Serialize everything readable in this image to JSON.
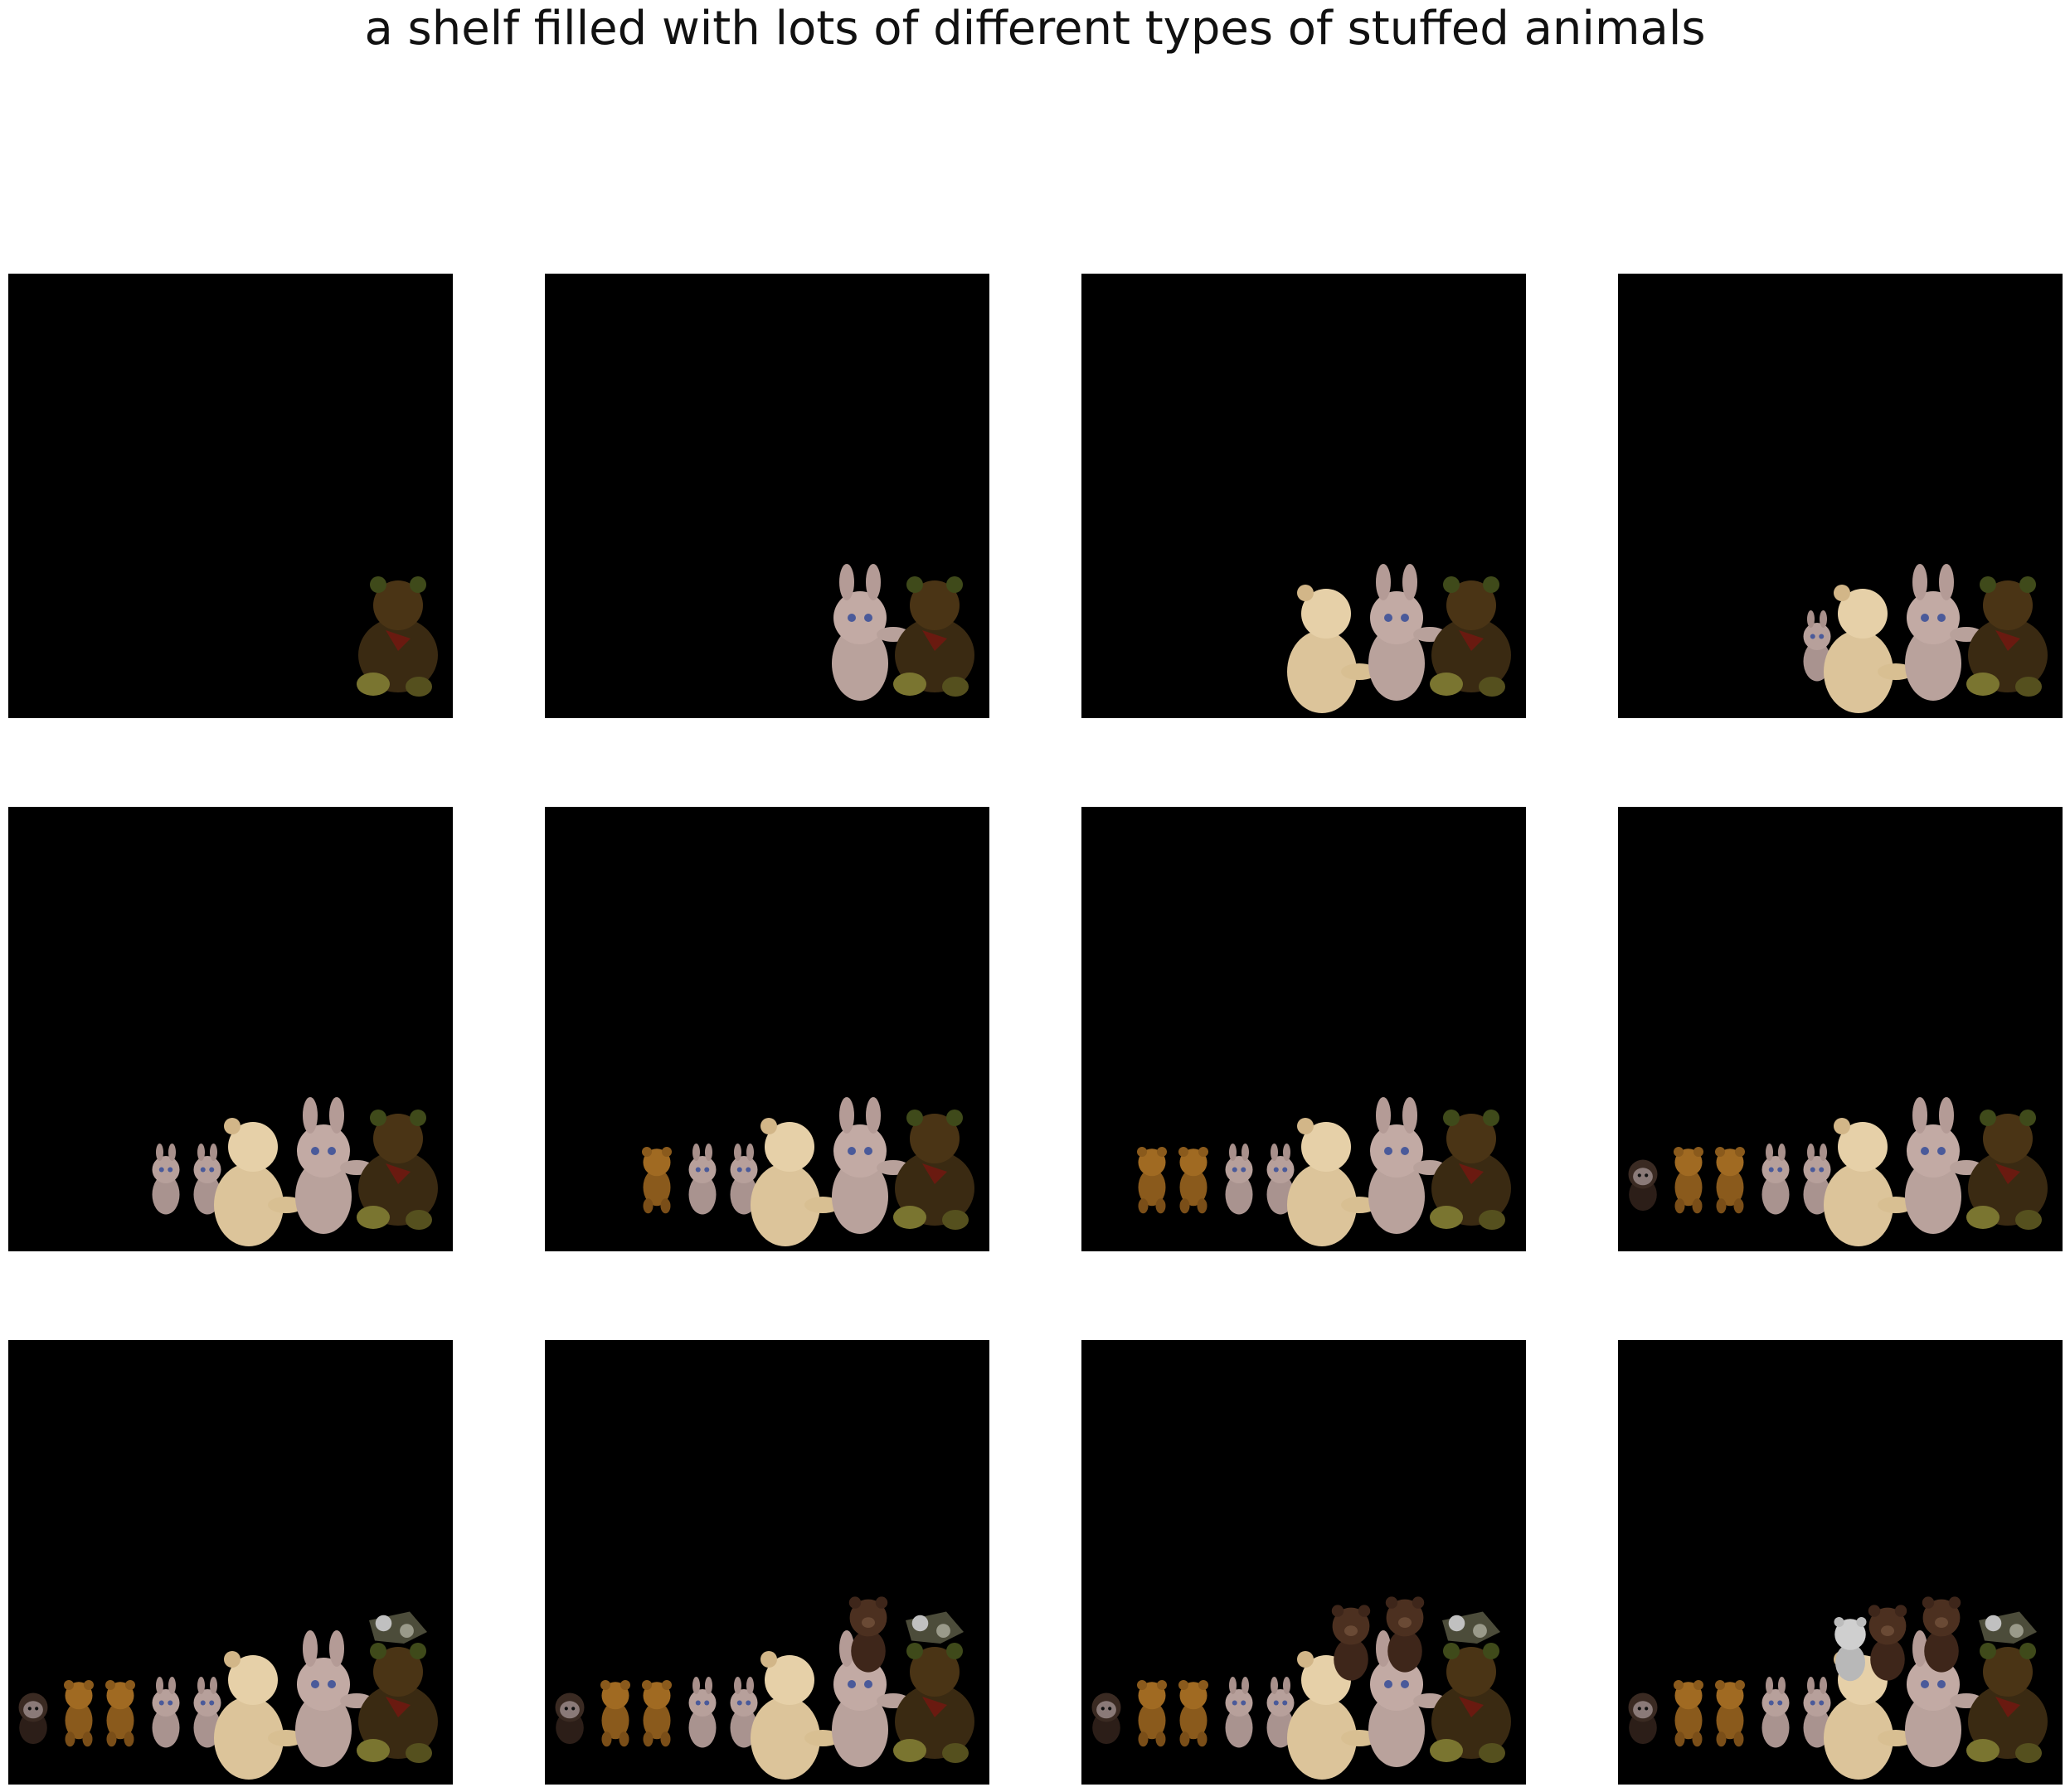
{
  "title": "a shelf filled with lots of different types of stuffed animals",
  "background_color": "#000000",
  "frames": [
    {
      "step": 1,
      "objects": [
        "brown-green-bear"
      ]
    },
    {
      "step": 2,
      "objects": [
        "pink-bunny",
        "brown-green-bear"
      ]
    },
    {
      "step": 3,
      "objects": [
        "cream-bear",
        "pink-bunny",
        "brown-green-bear"
      ]
    },
    {
      "step": 4,
      "objects": [
        "small-pink-bunny",
        "cream-bear",
        "pink-bunny",
        "brown-green-bear"
      ]
    },
    {
      "step": 5,
      "objects": [
        "small-pink-bunny",
        "small-pink-bunny",
        "cream-bear",
        "pink-bunny",
        "brown-green-bear"
      ]
    },
    {
      "step": 6,
      "objects": [
        "golden-teddy",
        "small-pink-bunny",
        "small-pink-bunny",
        "cream-bear",
        "pink-bunny",
        "brown-green-bear"
      ]
    },
    {
      "step": 7,
      "objects": [
        "golden-teddy",
        "golden-teddy",
        "small-pink-bunny",
        "small-pink-bunny",
        "cream-bear",
        "pink-bunny",
        "brown-green-bear"
      ]
    },
    {
      "step": 8,
      "objects": [
        "monkey",
        "golden-teddy",
        "golden-teddy",
        "small-pink-bunny",
        "small-pink-bunny",
        "cream-bear",
        "pink-bunny",
        "brown-green-bear"
      ]
    },
    {
      "step": 9,
      "objects": [
        "monkey",
        "golden-teddy",
        "golden-teddy",
        "small-pink-bunny",
        "small-pink-bunny",
        "cream-bear",
        "pink-bunny",
        "brown-green-bear",
        "grey-plush"
      ]
    },
    {
      "step": 10,
      "objects": [
        "monkey",
        "golden-teddy",
        "golden-teddy",
        "small-pink-bunny",
        "small-pink-bunny",
        "cream-bear",
        "pink-bunny",
        "brown-green-bear",
        "grey-plush",
        "brown-bear"
      ]
    },
    {
      "step": 11,
      "objects": [
        "monkey",
        "golden-teddy",
        "golden-teddy",
        "small-pink-bunny",
        "small-pink-bunny",
        "cream-bear",
        "pink-bunny",
        "brown-green-bear",
        "grey-plush",
        "brown-bear",
        "brown-bear"
      ]
    },
    {
      "step": 12,
      "objects": [
        "monkey",
        "golden-teddy",
        "golden-teddy",
        "small-pink-bunny",
        "small-pink-bunny",
        "cream-bear",
        "pink-bunny",
        "brown-green-bear",
        "grey-plush",
        "brown-bear",
        "brown-bear",
        "white-bear"
      ]
    }
  ]
}
